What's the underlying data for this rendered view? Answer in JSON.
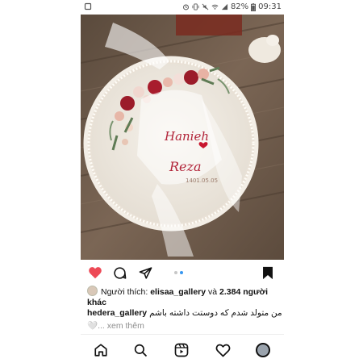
{
  "status_bar": {
    "battery_text": "82%",
    "time": "09:31"
  },
  "post": {
    "photo_texts": {
      "name1": "Hanieh",
      "name2": "Reza",
      "date": "1401.05.05"
    },
    "carousel": {
      "count": 2,
      "active": 2
    },
    "likes": {
      "prefix": "Người thích:",
      "user": "elisaa_gallery",
      "conj": "và",
      "count_text": "2.384 người khác"
    },
    "caption": {
      "username": "hedera_gallery",
      "text": "من متولد شدم که دوستت داشته باشم..."
    },
    "more_text": "🤍... xem thêm"
  },
  "icons": {
    "like": "heart-filled-icon",
    "comment": "comment-icon",
    "share": "send-icon",
    "save": "bookmark-icon",
    "home": "home-icon",
    "search": "search-icon",
    "reels": "reels-icon",
    "activity": "heart-outline-icon",
    "profile": "profile-avatar-icon"
  },
  "colors": {
    "like_red": "#ed4956",
    "carousel_active": "#3897f0",
    "carousel_inactive": "#c7c7c7",
    "muted_text": "#8e8e8e"
  }
}
